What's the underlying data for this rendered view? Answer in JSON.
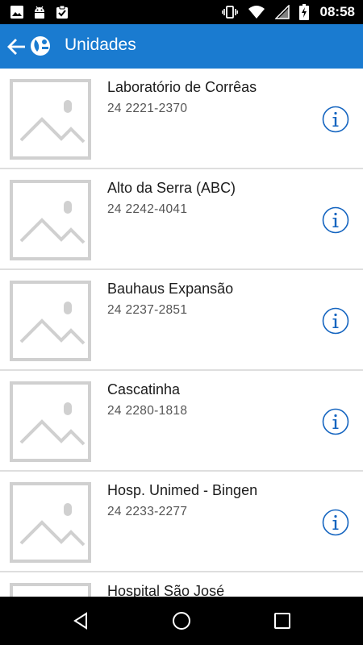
{
  "status_bar": {
    "time": "08:58",
    "left_icons": [
      "image-icon",
      "android-icon",
      "clipboard-check-icon"
    ],
    "right_icons": [
      "vibrate-icon",
      "wifi-icon",
      "signal-icon",
      "battery-charging-icon"
    ]
  },
  "app_bar": {
    "title": "Unidades",
    "back_icon": "arrow-left-icon",
    "logo_icon": "app-logo-icon",
    "color": "#1a7bd0"
  },
  "units": [
    {
      "name": "Laboratório de Corrêas",
      "phone": "24 2221-2370"
    },
    {
      "name": "Alto da Serra (ABC)",
      "phone": "24 2242-4041"
    },
    {
      "name": "Bauhaus Expansão",
      "phone": "24 2237-2851"
    },
    {
      "name": "Cascatinha",
      "phone": "24 2280-1818"
    },
    {
      "name": "Hosp. Unimed - Bingen",
      "phone": "24 2233-2277"
    },
    {
      "name": "Hospital São José",
      "phone": ""
    }
  ],
  "item_icons": {
    "thumbnail": "image-placeholder-icon",
    "info": "info-icon"
  },
  "nav_bar": {
    "icons": [
      "back-triangle-icon",
      "home-circle-icon",
      "recents-square-icon"
    ]
  },
  "colors": {
    "accent": "#1a7bd0",
    "info_icon": "#1565c0",
    "divider": "#dedede"
  }
}
